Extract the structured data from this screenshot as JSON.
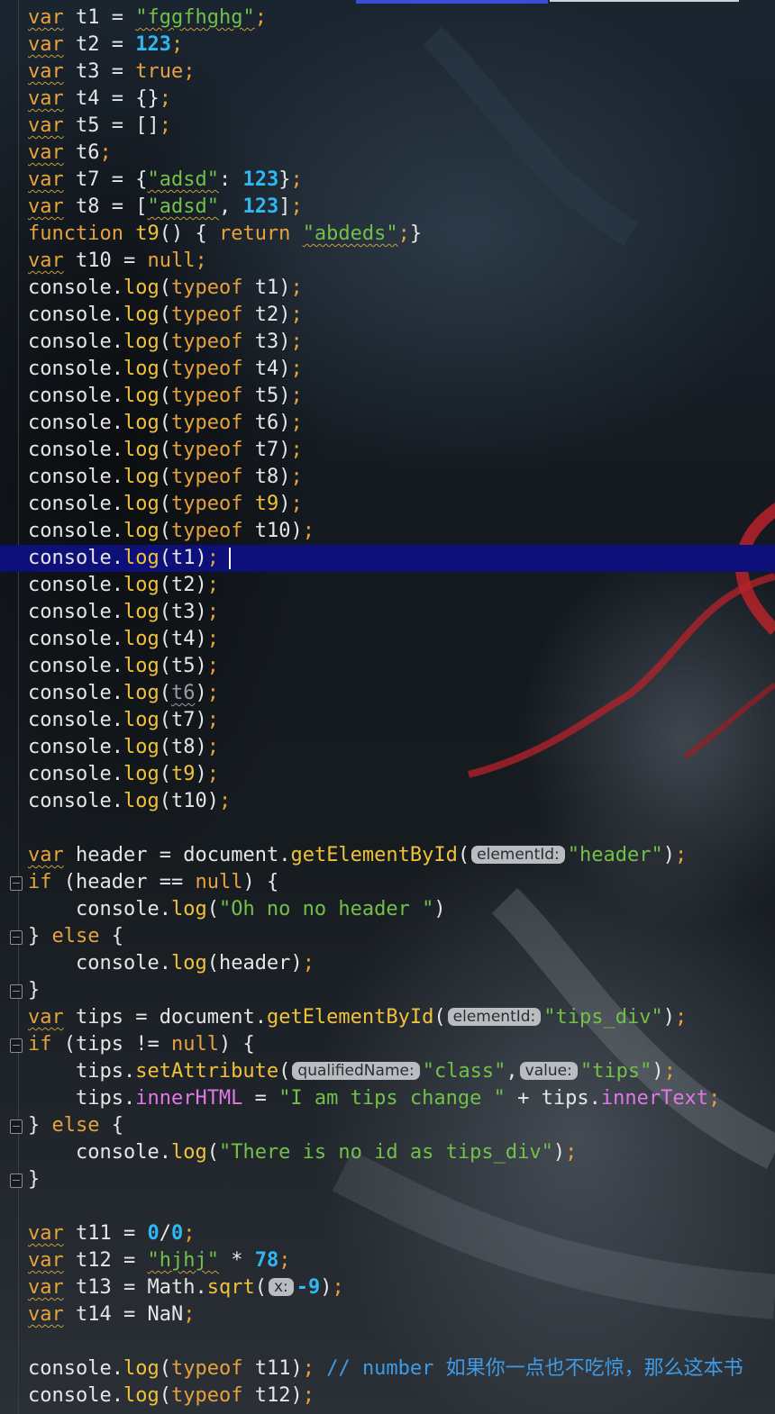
{
  "colors": {
    "keyword": "#e8a23c",
    "string": "#72c04a",
    "number": "#2fb8f2",
    "function": "#f0c23c",
    "property": "#e277e8",
    "comment": "#3f9be6",
    "current_line": "#0c1078",
    "tab_indicator": "#3b4bdc"
  },
  "code": {
    "v_t1": "var",
    "n_t1": "t1",
    "s_t1": "\"fggfhghg\"",
    "v_t2": "var",
    "n_t2": "t2",
    "num_t2": "123",
    "v_t3": "var",
    "n_t3": "t3",
    "bool_t3": "true",
    "v_t4": "var",
    "n_t4": "t4",
    "obj_t4": "{}",
    "v_t5": "var",
    "n_t5": "t5",
    "arr_t5": "[]",
    "v_t6": "var",
    "n_t6": "t6",
    "v_t7": "var",
    "n_t7": "t7",
    "s_t7": "\"adsd\"",
    "num_t7": "123",
    "v_t8": "var",
    "n_t8": "t8",
    "s_t8": "\"adsd\"",
    "num_t8": "123",
    "function_kw": "function",
    "fn_t9": "t9",
    "return_kw": "return",
    "s_t9": "\"abdeds\"",
    "v_t10": "var",
    "n_t10": "t10",
    "null_t10": "null",
    "console": "console",
    "log": "log",
    "typeof": "typeof",
    "args": [
      "t1",
      "t2",
      "t3",
      "t4",
      "t5",
      "t6",
      "t7",
      "t8",
      "t9",
      "t10"
    ],
    "v_header": "var",
    "n_header": "header",
    "document": "document",
    "getById": "getElementById",
    "hint_elementId": "elementId:",
    "s_header": "\"header\"",
    "if_kw": "if",
    "null": "null",
    "s_oh_no": "\"Oh no no header \"",
    "else_kw": "else",
    "v_tips": "var",
    "n_tips": "tips",
    "s_tips_div": "\"tips_div\"",
    "setAttribute": "setAttribute",
    "hint_qualifiedName": "qualifiedName:",
    "s_class": "\"class\"",
    "hint_value": "value:",
    "s_tips": "\"tips\"",
    "innerHTML": "innerHTML",
    "s_tips_change": "\"I am tips change \"",
    "innerText": "innerText",
    "s_no_id": "\"There is no id as tips_div\"",
    "v_t11": "var",
    "n_t11": "t11",
    "num_zero": "0",
    "v_t12": "var",
    "n_t12": "t12",
    "s_hjhj": "\"hjhj\"",
    "num_78": "78",
    "v_t13": "var",
    "n_t13": "t13",
    "math": "Math",
    "sqrt": "sqrt",
    "hint_x": "x:",
    "num_neg9": "-9",
    "v_t14": "var",
    "n_t14": "t14",
    "nan": "NaN",
    "comment_t11": "// number 如果你一点也不吃惊，那么这本书"
  }
}
